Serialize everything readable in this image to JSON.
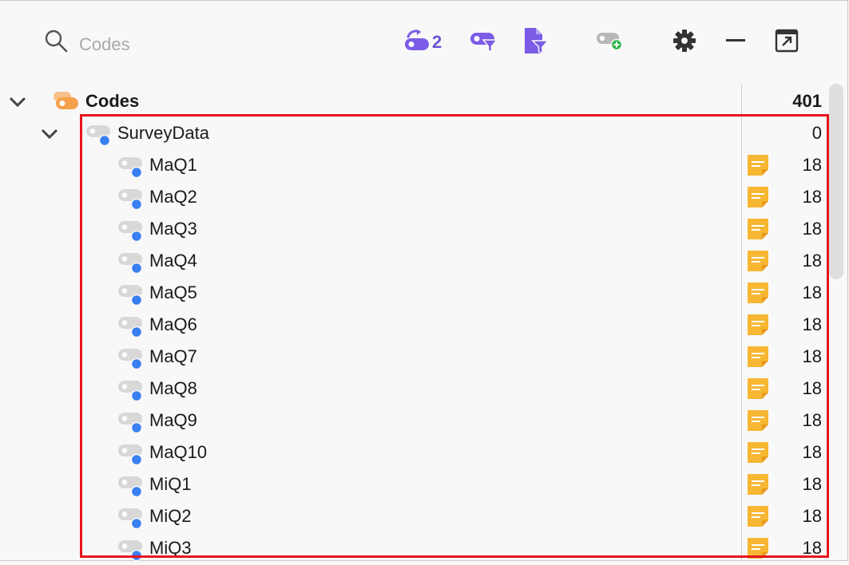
{
  "toolbar": {
    "search_placeholder": "Codes",
    "sets_count": "2",
    "icons": [
      "search-icon",
      "code-sets-icon",
      "code-filter-icon",
      "document-filter-icon",
      "new-code-icon",
      "gear-icon",
      "minimize-icon",
      "popout-icon"
    ],
    "accent_color": "#7b5ce6"
  },
  "tree": {
    "root": {
      "label": "Codes",
      "count": "401"
    },
    "group": {
      "label": "SurveyData",
      "count": "0"
    },
    "items": [
      {
        "label": "MaQ1",
        "count": "18"
      },
      {
        "label": "MaQ2",
        "count": "18"
      },
      {
        "label": "MaQ3",
        "count": "18"
      },
      {
        "label": "MaQ4",
        "count": "18"
      },
      {
        "label": "MaQ5",
        "count": "18"
      },
      {
        "label": "MaQ6",
        "count": "18"
      },
      {
        "label": "MaQ7",
        "count": "18"
      },
      {
        "label": "MaQ8",
        "count": "18"
      },
      {
        "label": "MaQ9",
        "count": "18"
      },
      {
        "label": "MaQ10",
        "count": "18"
      },
      {
        "label": "MiQ1",
        "count": "18"
      },
      {
        "label": "MiQ2",
        "count": "18"
      },
      {
        "label": "MiQ3",
        "count": "18"
      }
    ],
    "colors": {
      "root_icon": "#f5a04a",
      "code_dot": "#3a7ff0",
      "memo": "#f7b733",
      "highlight": "#e8141c"
    }
  }
}
